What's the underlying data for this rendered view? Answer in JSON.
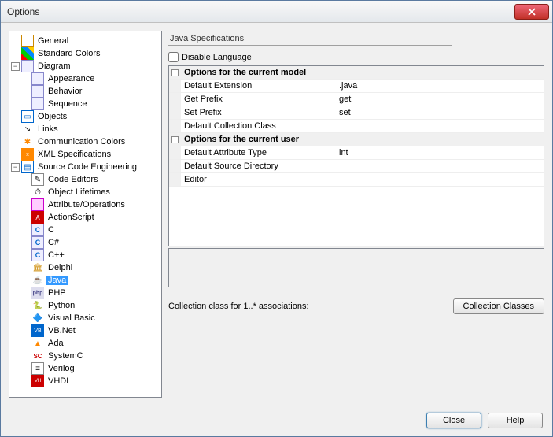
{
  "window": {
    "title": "Options"
  },
  "tree": {
    "general": "General",
    "standard_colors": "Standard Colors",
    "diagram": "Diagram",
    "appearance": "Appearance",
    "behavior": "Behavior",
    "sequence": "Sequence",
    "objects": "Objects",
    "links": "Links",
    "communication_colors": "Communication Colors",
    "xml_specifications": "XML Specifications",
    "source_code_engineering": "Source Code Engineering",
    "code_editors": "Code Editors",
    "object_lifetimes": "Object Lifetimes",
    "attribute_operations": "Attribute/Operations",
    "actionscript": "ActionScript",
    "c": "C",
    "csharp": "C#",
    "cpp": "C++",
    "delphi": "Delphi",
    "java": "Java",
    "php": "PHP",
    "python": "Python",
    "visual_basic": "Visual Basic",
    "vbnet": "VB.Net",
    "ada": "Ada",
    "systemc": "SystemC",
    "verilog": "Verilog",
    "vhdl": "VHDL"
  },
  "panel": {
    "heading": "Java Specifications",
    "disable_label": "Disable Language",
    "group_model": "Options for the current model",
    "group_user": "Options for the current user",
    "rows": {
      "default_extension": {
        "name": "Default Extension",
        "value": ".java"
      },
      "get_prefix": {
        "name": "Get Prefix",
        "value": "get"
      },
      "set_prefix": {
        "name": "Set Prefix",
        "value": "set"
      },
      "default_collection_class": {
        "name": "Default Collection Class",
        "value": ""
      },
      "default_attribute_type": {
        "name": "Default Attribute Type",
        "value": "int"
      },
      "default_source_directory": {
        "name": "Default Source Directory",
        "value": ""
      },
      "editor": {
        "name": "Editor",
        "value": ""
      }
    },
    "footer_label": "Collection class for 1..* associations:",
    "collection_classes_btn": "Collection Classes"
  },
  "buttons": {
    "close": "Close",
    "help": "Help"
  }
}
